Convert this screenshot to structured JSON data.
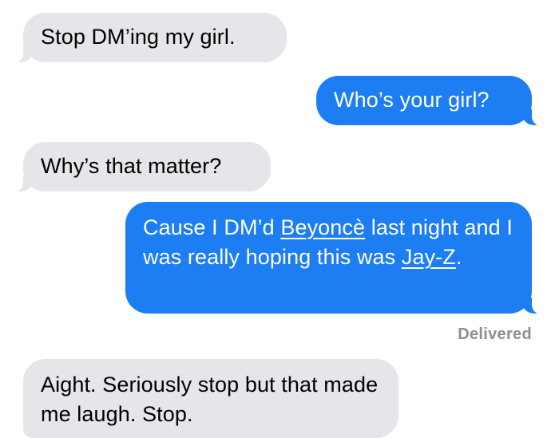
{
  "conversation": {
    "messages": [
      {
        "direction": "incoming",
        "text": "Stop DM’ing my girl."
      },
      {
        "direction": "outgoing",
        "text": "Who’s your girl?"
      },
      {
        "direction": "incoming",
        "text": "Why’s that matter?"
      },
      {
        "direction": "outgoing",
        "parts": {
          "p1": "Cause I DM’d ",
          "link1": "Beyoncè",
          "p2": " last night and I was really hoping this was ",
          "link2": "Jay-Z",
          "p3": "."
        }
      },
      {
        "direction": "incoming",
        "text": "Aight. Seriously stop but that made me laugh. Stop."
      }
    ],
    "status": "Delivered"
  },
  "colors": {
    "incoming_bubble": "#e5e5ea",
    "outgoing_bubble": "#1d7ef3",
    "status_text": "#8e8e93"
  }
}
